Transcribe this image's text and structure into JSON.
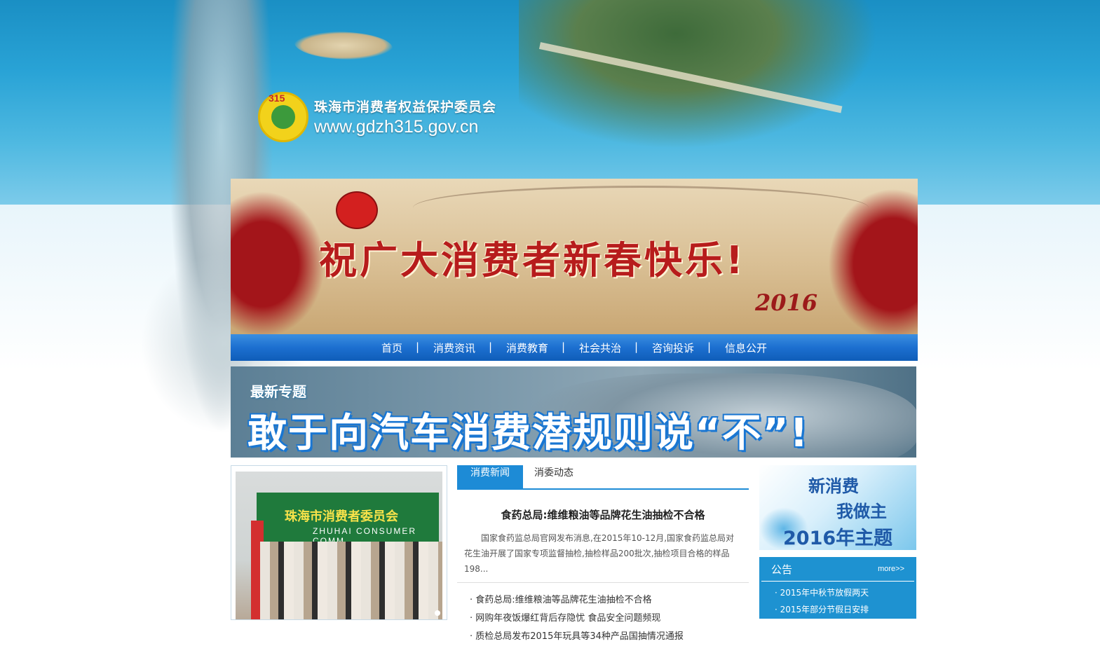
{
  "header": {
    "org_name": "珠海市消费者权益保护委员会",
    "website": "www.gdzh315.gov.cn",
    "logo_text": "315"
  },
  "holiday_banner": {
    "greeting": "祝广大消费者新春快乐!",
    "year": "2016"
  },
  "nav": {
    "items": [
      "首页",
      "消费资讯",
      "消费教育",
      "社会共治",
      "咨询投诉",
      "信息公开"
    ]
  },
  "feature_banner": {
    "tag": "最新专题",
    "title": "敢于向汽车消费潜规则说“不”!"
  },
  "photo": {
    "board_text": "珠海市消费者委员会",
    "board_subtext": "ZHUHAI CONSUMER COMM"
  },
  "news": {
    "tabs": [
      "消费新闻",
      "消委动态"
    ],
    "headline": "食药总局:维维粮油等品牌花生油抽检不合格",
    "summary": "国家食药监总局官网发布消息,在2015年10-12月,国家食药监总局对花生油开展了国家专项监督抽检,抽检样品200批次,抽检项目合格的样品198...",
    "list": [
      "· 食药总局:维维粮油等品牌花生油抽检不合格",
      "· 网购年夜饭爆红背后存隐忧 食品安全问题频现",
      "· 质检总局发布2015年玩具等34种产品国抽情况通报"
    ]
  },
  "theme": {
    "line1": "新消费",
    "line2": "我做主",
    "line3": "2016年主题"
  },
  "notice": {
    "title": "公告",
    "more": "more>>",
    "items": [
      "· 2015年中秋节放假两天",
      "· 2015年部分节假日安排"
    ]
  },
  "colors": {
    "nav_blue": "#1c6fd0",
    "tab_active": "#1d8bd6",
    "banner_red": "#b71c1c",
    "notice_blue": "#1e92d1"
  }
}
